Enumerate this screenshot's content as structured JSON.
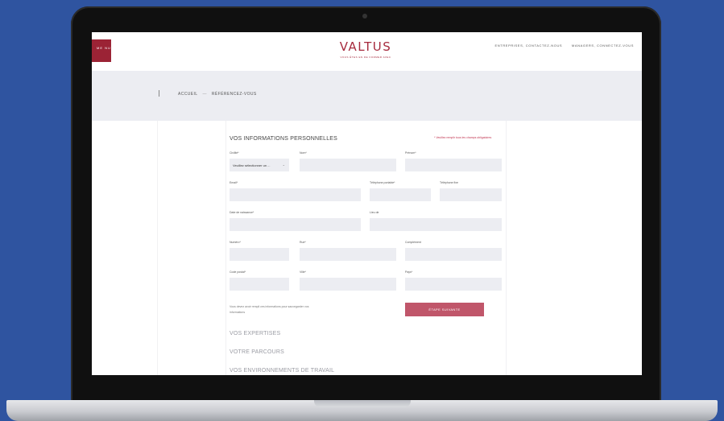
{
  "header": {
    "menu_label": "ME NU",
    "logo_text": "VALTUS",
    "logo_tagline": "VOUS ÊTES EN DE FORMER AVEC",
    "links": [
      "ENTREPRISES, CONTACTEZ-NOUS",
      "MANAGERS, CONNECTEZ-VOUS"
    ]
  },
  "breadcrumb": {
    "home": "ACCUEIL",
    "separator": "—",
    "current": "RÉFÉRENCEZ-VOUS"
  },
  "form": {
    "title": "VOS INFORMATIONS PERSONNELLES",
    "required_note": "* Veuillez remplir tous les champs obligatoires",
    "fields": {
      "civility_label": "Civilité*",
      "civility_value": "Veuillez sélectionner un ...",
      "lastname_label": "Nom*",
      "firstname_label": "Prénom*",
      "email_label": "Email*",
      "mobile_label": "Téléphone portable*",
      "landline_label": "Téléphone fixe",
      "birthdate_label": "Date de naissance*",
      "birthplace_label": "Lieu de",
      "number_label": "Numéro*",
      "street_label": "Rue*",
      "complement_label": "Complément",
      "postcode_label": "Code postal*",
      "city_label": "Ville*",
      "country_label": "Pays*"
    },
    "help_text": "Vous devez avoir rempli ces informations pour sauvegarder vos informations",
    "next_button": "ÉTAPE SUIVANTE"
  },
  "sections": [
    "VOS EXPERTISES",
    "VOTRE PARCOURS",
    "VOS ENVIRONNEMENTS DE TRAVAIL"
  ],
  "colors": {
    "brand": "#9b2335",
    "button": "#c0566a",
    "field": "#ecedf2",
    "background": "#2f54a0"
  }
}
